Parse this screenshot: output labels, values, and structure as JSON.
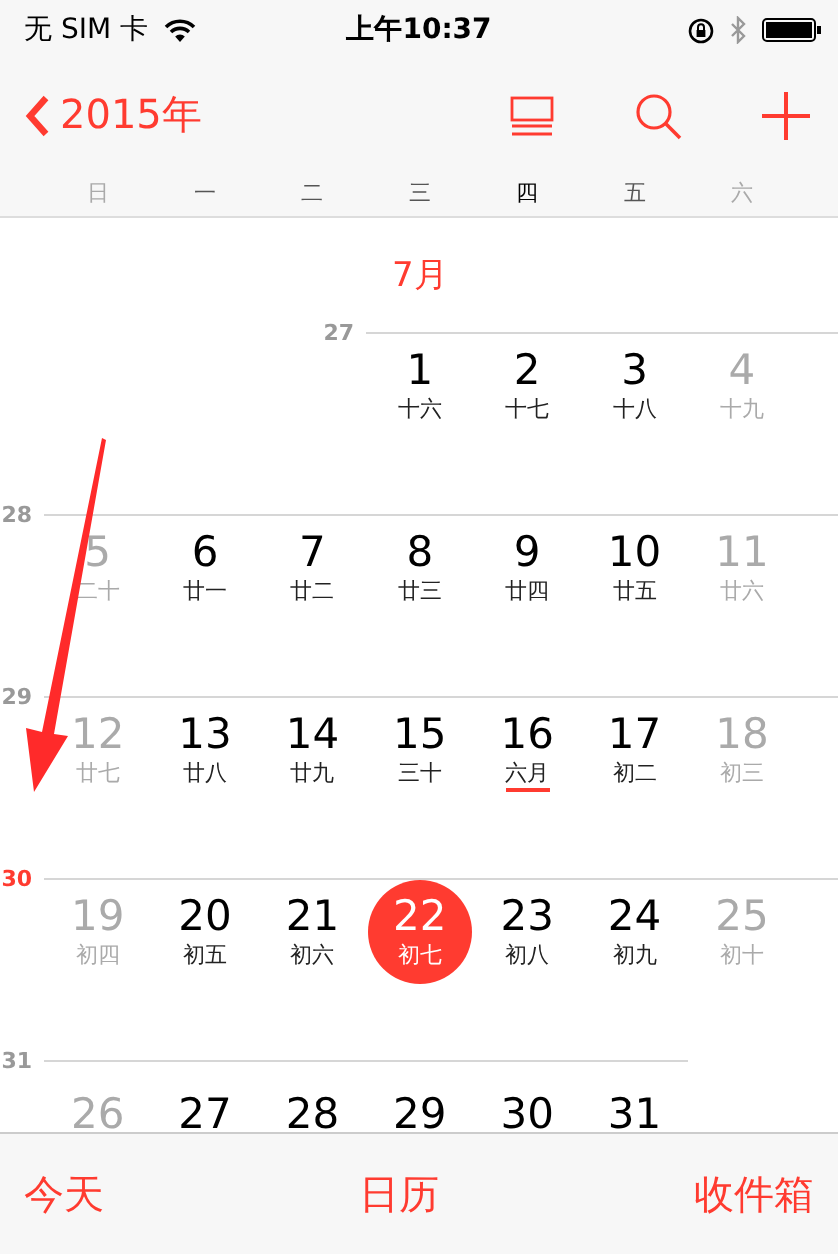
{
  "status_bar": {
    "carrier": "无 SIM 卡",
    "time": "上午10:37"
  },
  "nav_bar": {
    "back_label": "2015年"
  },
  "weekdays": [
    {
      "label": "日",
      "dimmed": true,
      "selected": false
    },
    {
      "label": "一",
      "dimmed": false,
      "selected": false
    },
    {
      "label": "二",
      "dimmed": false,
      "selected": false
    },
    {
      "label": "三",
      "dimmed": false,
      "selected": false
    },
    {
      "label": "四",
      "dimmed": false,
      "selected": true
    },
    {
      "label": "五",
      "dimmed": false,
      "selected": false
    },
    {
      "label": "六",
      "dimmed": true,
      "selected": false
    }
  ],
  "month_label": "7月",
  "weeks": [
    {
      "number": "27",
      "current": false,
      "days": [
        {
          "kind": "blank"
        },
        {
          "kind": "blank"
        },
        {
          "kind": "blank"
        },
        {
          "kind": "day",
          "day": "1",
          "lunar": "十六",
          "dimmed": false,
          "selected": false,
          "month_start": false
        },
        {
          "kind": "day",
          "day": "2",
          "lunar": "十七",
          "dimmed": false,
          "selected": false,
          "month_start": false
        },
        {
          "kind": "day",
          "day": "3",
          "lunar": "十八",
          "dimmed": false,
          "selected": false,
          "month_start": false
        },
        {
          "kind": "day",
          "day": "4",
          "lunar": "十九",
          "dimmed": true,
          "selected": false,
          "month_start": false
        }
      ]
    },
    {
      "number": "28",
      "current": false,
      "days": [
        {
          "kind": "day",
          "day": "5",
          "lunar": "二十",
          "dimmed": true,
          "selected": false,
          "month_start": false
        },
        {
          "kind": "day",
          "day": "6",
          "lunar": "廿一",
          "dimmed": false,
          "selected": false,
          "month_start": false
        },
        {
          "kind": "day",
          "day": "7",
          "lunar": "廿二",
          "dimmed": false,
          "selected": false,
          "month_start": false
        },
        {
          "kind": "day",
          "day": "8",
          "lunar": "廿三",
          "dimmed": false,
          "selected": false,
          "month_start": false
        },
        {
          "kind": "day",
          "day": "9",
          "lunar": "廿四",
          "dimmed": false,
          "selected": false,
          "month_start": false
        },
        {
          "kind": "day",
          "day": "10",
          "lunar": "廿五",
          "dimmed": false,
          "selected": false,
          "month_start": false
        },
        {
          "kind": "day",
          "day": "11",
          "lunar": "廿六",
          "dimmed": true,
          "selected": false,
          "month_start": false
        }
      ]
    },
    {
      "number": "29",
      "current": false,
      "days": [
        {
          "kind": "day",
          "day": "12",
          "lunar": "廿七",
          "dimmed": true,
          "selected": false,
          "month_start": false
        },
        {
          "kind": "day",
          "day": "13",
          "lunar": "廿八",
          "dimmed": false,
          "selected": false,
          "month_start": false
        },
        {
          "kind": "day",
          "day": "14",
          "lunar": "廿九",
          "dimmed": false,
          "selected": false,
          "month_start": false
        },
        {
          "kind": "day",
          "day": "15",
          "lunar": "三十",
          "dimmed": false,
          "selected": false,
          "month_start": false
        },
        {
          "kind": "day",
          "day": "16",
          "lunar": "六月",
          "dimmed": false,
          "selected": false,
          "month_start": true
        },
        {
          "kind": "day",
          "day": "17",
          "lunar": "初二",
          "dimmed": false,
          "selected": false,
          "month_start": false
        },
        {
          "kind": "day",
          "day": "18",
          "lunar": "初三",
          "dimmed": true,
          "selected": false,
          "month_start": false
        }
      ]
    },
    {
      "number": "30",
      "current": true,
      "days": [
        {
          "kind": "day",
          "day": "19",
          "lunar": "初四",
          "dimmed": true,
          "selected": false,
          "month_start": false
        },
        {
          "kind": "day",
          "day": "20",
          "lunar": "初五",
          "dimmed": false,
          "selected": false,
          "month_start": false
        },
        {
          "kind": "day",
          "day": "21",
          "lunar": "初六",
          "dimmed": false,
          "selected": false,
          "month_start": false
        },
        {
          "kind": "day",
          "day": "22",
          "lunar": "初七",
          "dimmed": false,
          "selected": true,
          "month_start": false
        },
        {
          "kind": "day",
          "day": "23",
          "lunar": "初八",
          "dimmed": false,
          "selected": false,
          "month_start": false
        },
        {
          "kind": "day",
          "day": "24",
          "lunar": "初九",
          "dimmed": false,
          "selected": false,
          "month_start": false
        },
        {
          "kind": "day",
          "day": "25",
          "lunar": "初十",
          "dimmed": true,
          "selected": false,
          "month_start": false
        }
      ]
    },
    {
      "number": "31",
      "current": false,
      "days": [
        {
          "kind": "day",
          "day": "26",
          "dimmed": true,
          "selected": false
        },
        {
          "kind": "day",
          "day": "27",
          "dimmed": false,
          "selected": false
        },
        {
          "kind": "day",
          "day": "28",
          "dimmed": false,
          "selected": false
        },
        {
          "kind": "day",
          "day": "29",
          "dimmed": false,
          "selected": false
        },
        {
          "kind": "day",
          "day": "30",
          "dimmed": false,
          "selected": false
        },
        {
          "kind": "day",
          "day": "31",
          "dimmed": false,
          "selected": false
        }
      ]
    }
  ],
  "tab_bar": [
    {
      "label": "今天"
    },
    {
      "label": "日历"
    },
    {
      "label": "收件箱"
    }
  ]
}
